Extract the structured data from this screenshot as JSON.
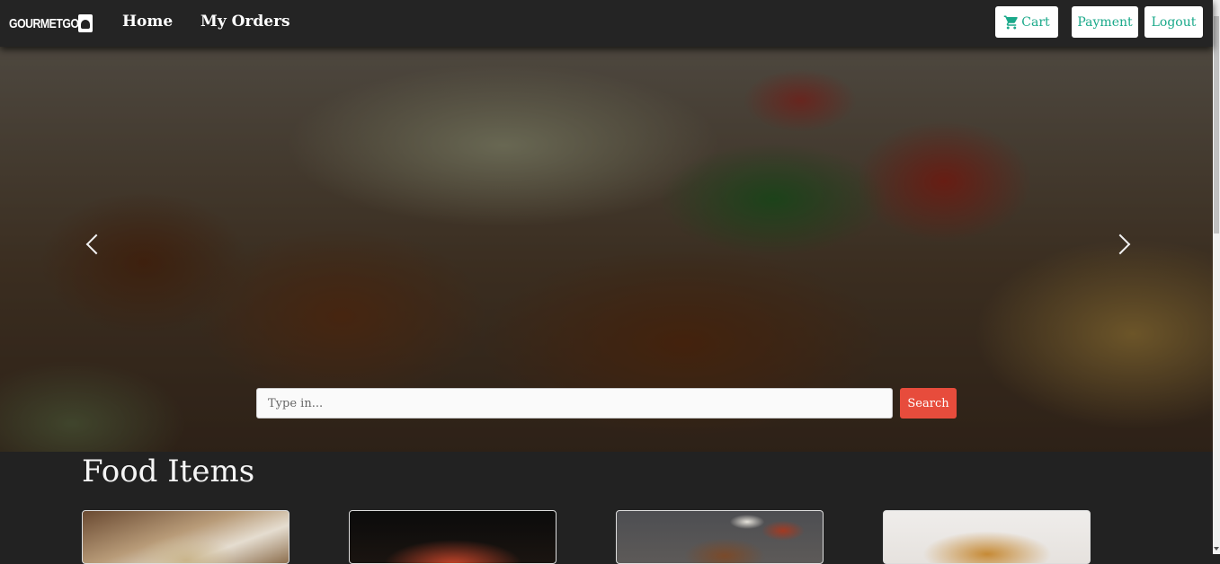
{
  "brand": {
    "name": "GOURMETGO"
  },
  "nav": {
    "home": "Home",
    "orders": "My Orders"
  },
  "actions": {
    "cart": "Cart",
    "payment": "Payment",
    "logout": "Logout"
  },
  "search": {
    "placeholder": "Type in...",
    "value": "",
    "button": "Search"
  },
  "section": {
    "title": "Food Items"
  },
  "colors": {
    "accent": "#1aa98a",
    "search_button": "#e74c3c",
    "background": "#222222"
  },
  "icons": [
    "cart-icon",
    "chevron-left-icon",
    "chevron-right-icon",
    "chef-logo-icon"
  ]
}
